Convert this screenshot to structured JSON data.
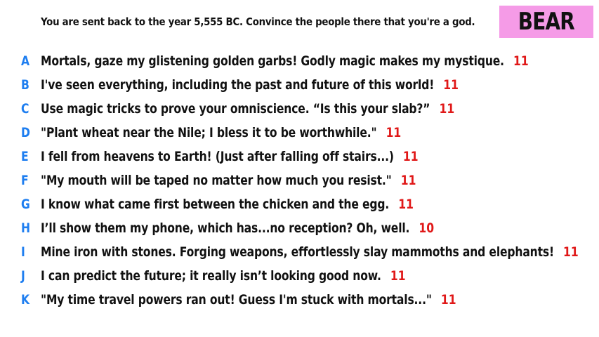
{
  "prompt": "You are sent back to the year 5,555 BC. Convince the people there that you're a god.",
  "player_tag": "BEAR",
  "colors": {
    "letter": "#1e7ef0",
    "score": "#e01818",
    "badge_bg": "#f59be7"
  },
  "answers": [
    {
      "letter": "A",
      "text": "Mortals, gaze my glistening golden garbs! Godly magic makes my mystique.",
      "score": "11"
    },
    {
      "letter": "B",
      "text": "I've seen everything, including the past and future of this world!",
      "score": "11"
    },
    {
      "letter": "C",
      "text": "Use magic tricks to prove your omniscience. “Is this your slab?”",
      "score": "11"
    },
    {
      "letter": "D",
      "text": "\"Plant wheat near the Nile; I bless it to be worthwhile.\"",
      "score": "11"
    },
    {
      "letter": "E",
      "text": "I fell from heavens to Earth! (Just after falling off stairs...)",
      "score": "11"
    },
    {
      "letter": "F",
      "text": "\"My mouth will be taped no matter how much you resist.\"",
      "score": "11"
    },
    {
      "letter": "G",
      "text": "I know what came first between the chicken and the egg.",
      "score": "11"
    },
    {
      "letter": "H",
      "text": "I’ll show them my phone, which has...no reception? Oh, well.",
      "score": "10"
    },
    {
      "letter": "I",
      "text": "Mine iron with stones. Forging weapons, effortlessly slay mammoths and elephants!",
      "score": "11"
    },
    {
      "letter": "J",
      "text": "I can predict the future; it really isn’t looking good now.",
      "score": "11"
    },
    {
      "letter": "K",
      "text": "\"My time travel powers ran out! Guess I'm stuck with mortals...\"",
      "score": "11"
    }
  ]
}
